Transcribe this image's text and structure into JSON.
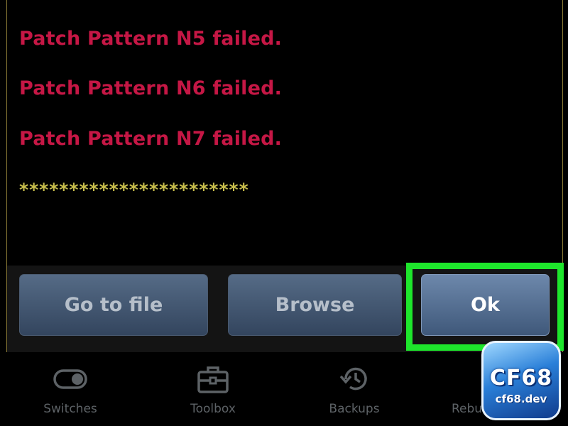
{
  "log": {
    "lines": [
      "Patch Pattern N5 failed.",
      "Patch Pattern N6 failed.",
      "Patch Pattern N7 failed."
    ],
    "separator": "***********************"
  },
  "dialog_buttons": {
    "go_to_file": "Go to file",
    "browse": "Browse",
    "ok": "Ok"
  },
  "bottom_nav": {
    "items": [
      {
        "label": "Switches",
        "icon": "toggle-switch-icon"
      },
      {
        "label": "Toolbox",
        "icon": "toolbox-icon"
      },
      {
        "label": "Backups",
        "icon": "backup-restore-icon"
      },
      {
        "label": "Rebuild",
        "icon": "rebuild-icon"
      }
    ]
  },
  "watermark": {
    "main": "CF68",
    "sub": "cf68.dev"
  },
  "colors": {
    "error_text": "#c51745",
    "separator_text": "#c9bf4c",
    "highlight": "#1ee62c",
    "button": "#445a77"
  }
}
